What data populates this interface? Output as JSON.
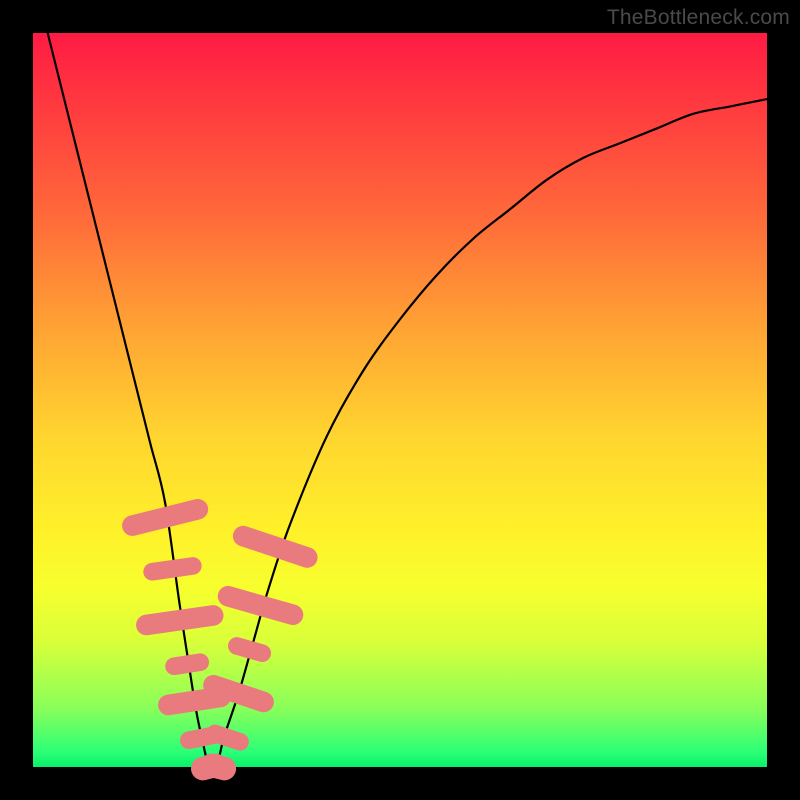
{
  "watermark": "TheBottleneck.com",
  "colors": {
    "background": "#000000",
    "gradient_top": "#ff1b44",
    "gradient_bottom": "#08f06a",
    "curve": "#000000",
    "marker": "#e97a7d"
  },
  "chart_data": {
    "type": "line",
    "title": "",
    "xlabel": "",
    "ylabel": "",
    "xlim": [
      0,
      100
    ],
    "ylim": [
      0,
      100
    ],
    "series": [
      {
        "name": "bottleneck-curve",
        "x": [
          2,
          4,
          6,
          8,
          10,
          12,
          14,
          16,
          18,
          20,
          22,
          23,
          24,
          25,
          26,
          28,
          30,
          32,
          35,
          40,
          45,
          50,
          55,
          60,
          65,
          70,
          75,
          80,
          85,
          90,
          95,
          100
        ],
        "y": [
          100,
          92,
          84,
          76,
          68,
          60,
          52,
          44,
          36,
          22,
          9,
          4,
          0,
          0,
          4,
          10,
          17,
          24,
          33,
          45,
          54,
          61,
          67,
          72,
          76,
          80,
          83,
          85,
          87,
          89,
          90,
          91
        ]
      }
    ],
    "markers": {
      "name": "highlight-cluster",
      "points": [
        {
          "x": 18,
          "xw": 1.4,
          "y": 34,
          "yw": 6
        },
        {
          "x": 19,
          "xw": 1.2,
          "y": 27,
          "yw": 4
        },
        {
          "x": 20,
          "xw": 1.4,
          "y": 20,
          "yw": 6
        },
        {
          "x": 21,
          "xw": 1.2,
          "y": 14,
          "yw": 3
        },
        {
          "x": 22,
          "xw": 1.4,
          "y": 9,
          "yw": 5
        },
        {
          "x": 23,
          "xw": 1.2,
          "y": 4,
          "yw": 3
        },
        {
          "x": 24,
          "xw": 1.6,
          "y": 0,
          "yw": 2.5
        },
        {
          "x": 25.2,
          "xw": 1.6,
          "y": 0,
          "yw": 2.5
        },
        {
          "x": 26.5,
          "xw": 1.2,
          "y": 4,
          "yw": 3
        },
        {
          "x": 28,
          "xw": 1.4,
          "y": 10,
          "yw": 5
        },
        {
          "x": 29.5,
          "xw": 1.2,
          "y": 16,
          "yw": 3
        },
        {
          "x": 31,
          "xw": 1.4,
          "y": 22,
          "yw": 6
        },
        {
          "x": 33,
          "xw": 1.4,
          "y": 30,
          "yw": 6
        }
      ]
    }
  }
}
